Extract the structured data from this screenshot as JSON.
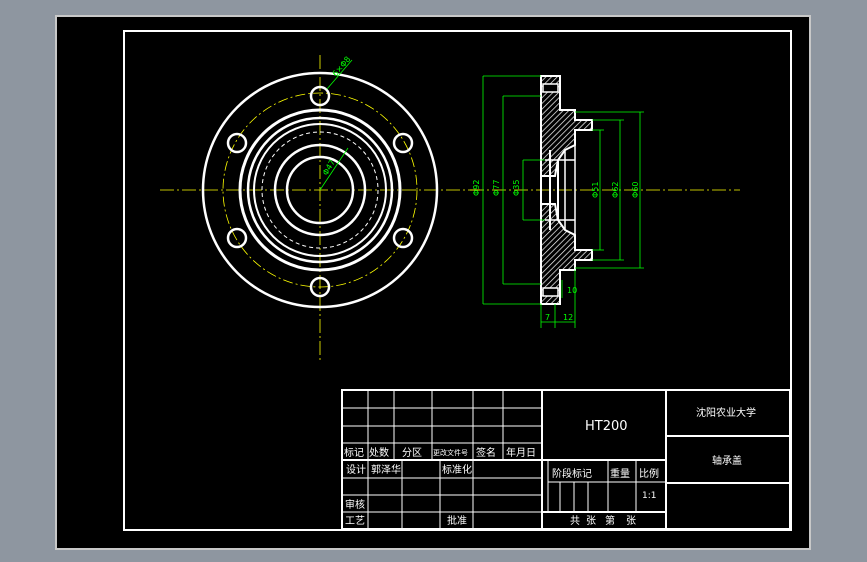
{
  "drawing": {
    "material": "HT200",
    "school": "沈阳农业大学",
    "part_name": "轴承盖",
    "scale_value": "1:1"
  },
  "title_block": {
    "rev_headers": [
      "标记",
      "处数",
      "分区",
      "更改文件号",
      "签名",
      "年月日"
    ],
    "design": "设计",
    "design_name": "郭泽华",
    "standardize": "标准化",
    "stage_mark": "阶段标记",
    "weight": "重量",
    "scale": "比例",
    "review": "审核",
    "process": "工艺",
    "approve": "批准",
    "sheet_total": "共",
    "sheet_unit": "张",
    "sheet_no": "第",
    "sheet_unit2": "张"
  },
  "dimensions": {
    "holes": "6×Φ8",
    "inner_bore": "Φ47",
    "d_outer": "Φ92",
    "d_mid": "Φ77",
    "d_inner": "Φ35",
    "d_hub1": "Φ51",
    "d_hub2": "Φ62",
    "d_hub3": "Φ60",
    "small": "10",
    "w1": "7",
    "w2": "12"
  },
  "colors": {
    "background": "#000000",
    "line": "#ffffff",
    "center": "#ffff00",
    "dimension": "#00ff00",
    "hatch": "#ffffff"
  }
}
